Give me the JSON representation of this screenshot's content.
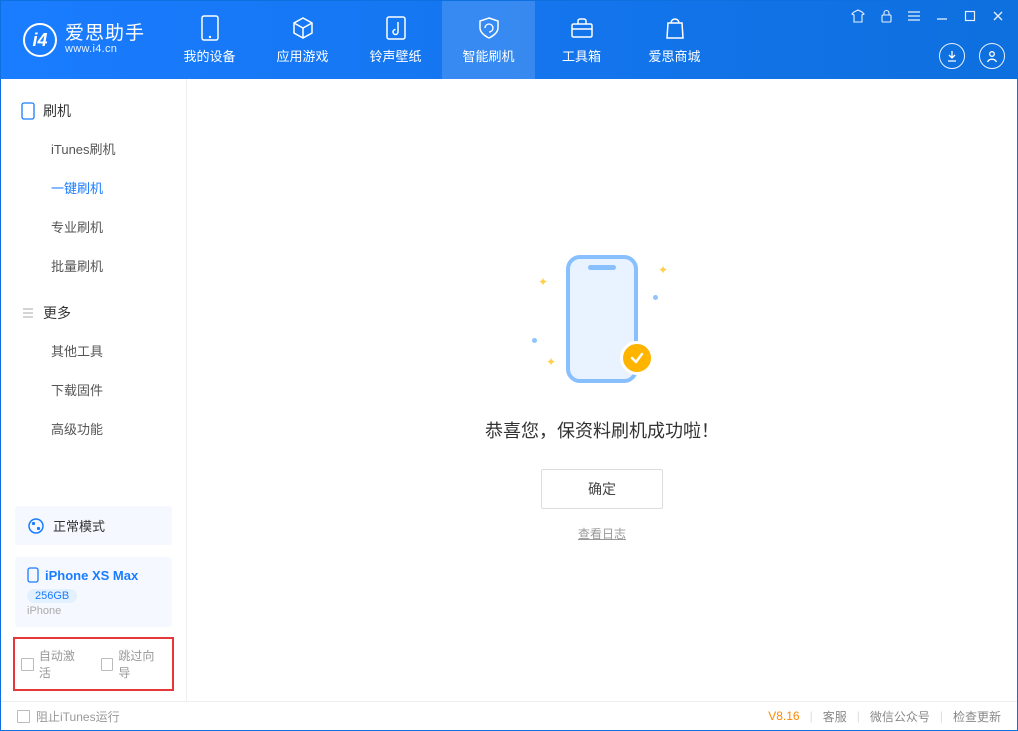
{
  "app": {
    "name": "爱思助手",
    "url": "www.i4.cn"
  },
  "nav": {
    "items": [
      {
        "label": "我的设备"
      },
      {
        "label": "应用游戏"
      },
      {
        "label": "铃声壁纸"
      },
      {
        "label": "智能刷机"
      },
      {
        "label": "工具箱"
      },
      {
        "label": "爱思商城"
      }
    ],
    "active_index": 3
  },
  "sidebar": {
    "section1": {
      "title": "刷机",
      "items": [
        "iTunes刷机",
        "一键刷机",
        "专业刷机",
        "批量刷机"
      ],
      "active_index": 1
    },
    "section2": {
      "title": "更多",
      "items": [
        "其他工具",
        "下载固件",
        "高级功能"
      ]
    },
    "mode_card": "正常模式",
    "device": {
      "name": "iPhone XS Max",
      "storage": "256GB",
      "type": "iPhone"
    },
    "bottom_checks": [
      "自动激活",
      "跳过向导"
    ]
  },
  "main": {
    "success_text": "恭喜您，保资料刷机成功啦！",
    "ok_button": "确定",
    "view_log": "查看日志"
  },
  "statusbar": {
    "block_itunes": "阻止iTunes运行",
    "version": "V8.16",
    "links": [
      "客服",
      "微信公众号",
      "检查更新"
    ]
  }
}
